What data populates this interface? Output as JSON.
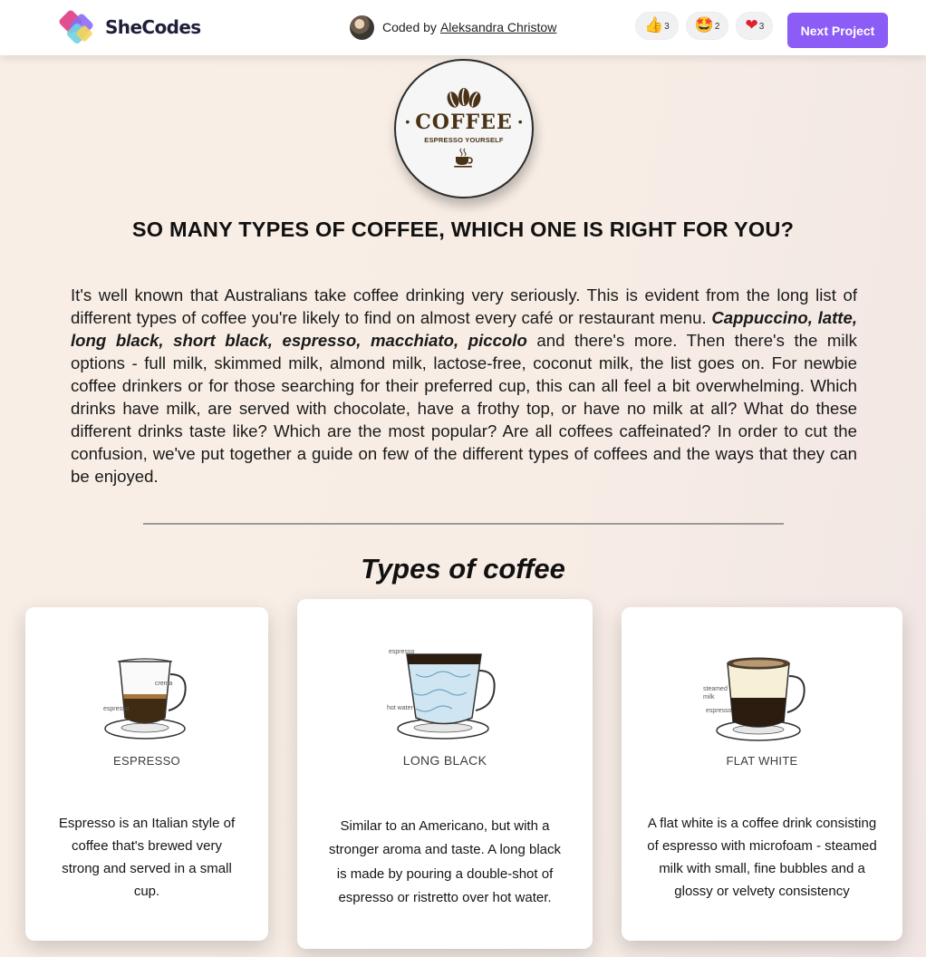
{
  "topbar": {
    "brand": "SheCodes",
    "coded_by_prefix": "Coded by",
    "author": "Aleksandra Christow",
    "reactions": [
      {
        "icon": "thumbs-up-icon",
        "emoji": "👍",
        "count": "3"
      },
      {
        "icon": "star-struck-icon",
        "emoji": "🤩",
        "count": "2"
      },
      {
        "icon": "heart-icon",
        "emoji": "❤",
        "count": "3"
      }
    ],
    "next_label": "Next Project",
    "accent": "#8b5cf6"
  },
  "logo": {
    "word": "COFFEE",
    "tagline": "ESPRESSO YOURSELF",
    "color": "#4a3217"
  },
  "headline": "SO MANY TYPES OF COFFEE, WHICH ONE IS RIGHT FOR YOU?",
  "intro": {
    "lead": "It's well known that Australians take coffee drinking very seriously. This is evident from the long list of different types of coffee you're likely to find on almost every café or restaurant menu.",
    "emphasis": "Cappuccino, latte, long black, short black, espresso, macchiato, piccolo",
    "rest": "and there's more. Then there's the milk options - full milk, skimmed milk, almond milk, lactose-free, coconut milk, the list goes on. For newbie coffee drinkers or for those searching for their preferred cup, this can all feel a bit overwhelming. Which drinks have milk, are served with chocolate, have a frothy top, or have no milk at all? What do these different drinks taste like? Which are the most popular? Are all coffees caffeinated? In order to cut the confusion, we've put together a guide on few of the different types of coffees and the ways that they can be enjoyed."
  },
  "section_title": "Types of coffee",
  "cards": [
    {
      "name": "ESPRESSO",
      "labels": [
        "crema",
        "espresso"
      ],
      "description": "Espresso is an Italian style of coffee that's brewed very strong and served in a small cup."
    },
    {
      "name": "LONG BLACK",
      "labels": [
        "espresso",
        "hot water"
      ],
      "description": "Similar to an Americano, but with a stronger aroma and taste. A long black is made by pouring a double-shot of espresso or ristretto over hot water."
    },
    {
      "name": "FLAT WHITE",
      "labels": [
        "steamed milk",
        "espresso"
      ],
      "description": "A flat white is a coffee drink consisting of espresso with microfoam - steamed milk with small, fine bubbles and a glossy or velvety consistency"
    }
  ]
}
